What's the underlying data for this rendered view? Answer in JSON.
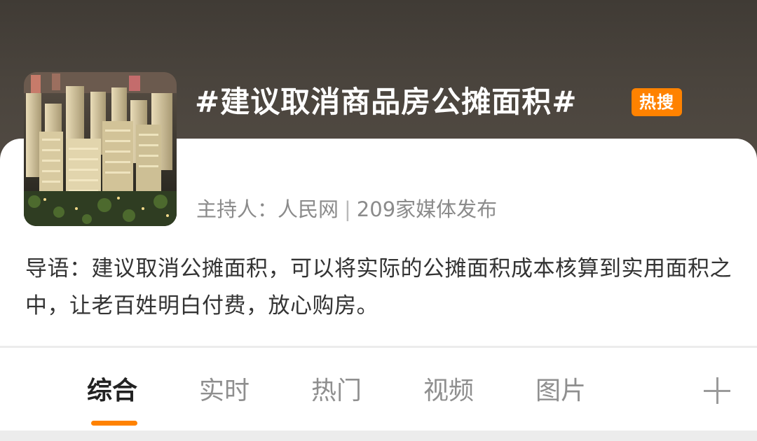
{
  "topic": {
    "title": "#建议取消商品房公摊面积#",
    "badge": "热搜",
    "badge_color": "#ff8200",
    "thumbnail_icon": "building-model-image"
  },
  "host": {
    "label": "主持人：人民网",
    "separator": "|",
    "media_count": "209家媒体发布"
  },
  "intro": {
    "text": "导语：建议取消公摊面积，可以将实际的公摊面积成本核算到实用面积之中，让老百姓明白付费，放心购房。"
  },
  "tabs": [
    {
      "label": "综合",
      "active": true
    },
    {
      "label": "实时",
      "active": false
    },
    {
      "label": "热门",
      "active": false
    },
    {
      "label": "视频",
      "active": false
    },
    {
      "label": "图片",
      "active": false
    }
  ],
  "tabs_more_icon": "plus-icon",
  "accent_color": "#ff8200"
}
